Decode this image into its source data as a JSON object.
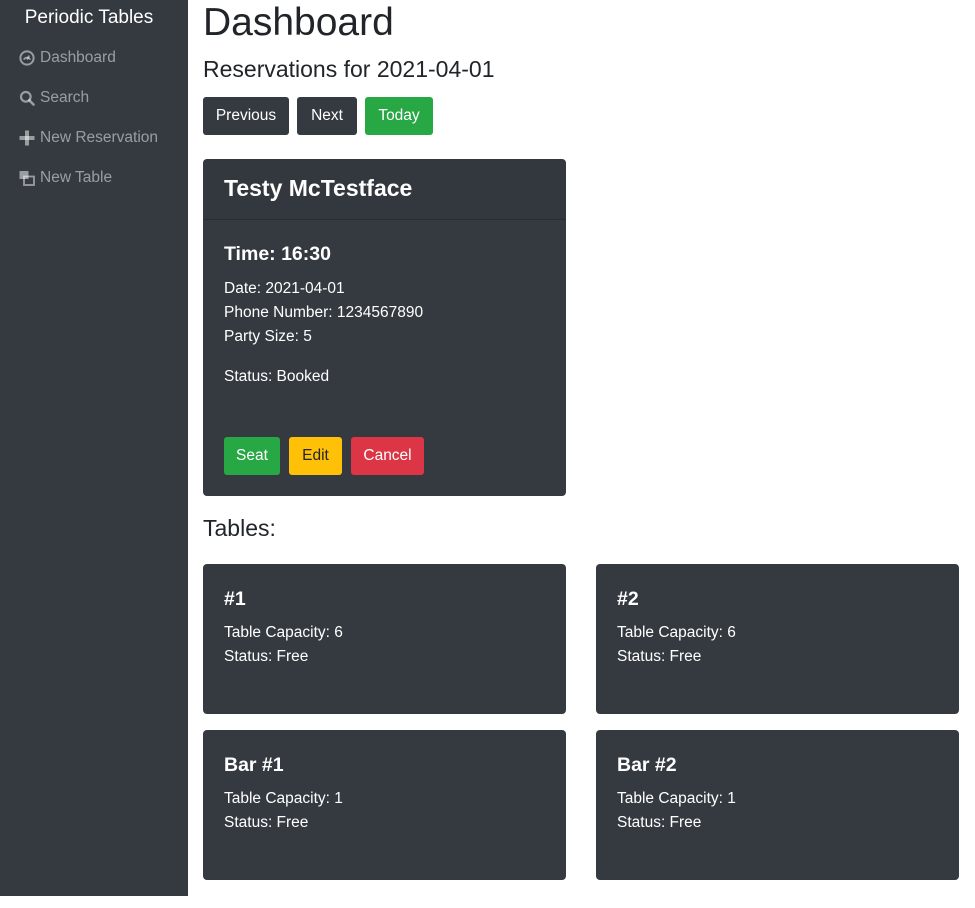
{
  "sidebar": {
    "brand": "Periodic Tables",
    "items": [
      {
        "label": "Dashboard",
        "icon": "dashboard-icon"
      },
      {
        "label": "Search",
        "icon": "search-icon"
      },
      {
        "label": "New Reservation",
        "icon": "plus-icon"
      },
      {
        "label": "New Table",
        "icon": "layers-icon"
      }
    ]
  },
  "header": {
    "title": "Dashboard",
    "subtitle": "Reservations for 2021-04-01"
  },
  "date_nav": {
    "previous": "Previous",
    "next": "Next",
    "today": "Today"
  },
  "reservation": {
    "name": "Testy McTestface",
    "time": "Time: 16:30",
    "date": "Date: 2021-04-01",
    "phone": "Phone Number: 1234567890",
    "party_size": "Party Size: 5",
    "status": "Status: Booked",
    "actions": {
      "seat": "Seat",
      "edit": "Edit",
      "cancel": "Cancel"
    }
  },
  "tables": {
    "heading": "Tables:",
    "items": [
      {
        "name": "#1",
        "capacity": "Table Capacity: 6",
        "status": "Status: Free"
      },
      {
        "name": "#2",
        "capacity": "Table Capacity: 6",
        "status": "Status: Free"
      },
      {
        "name": "Bar #1",
        "capacity": "Table Capacity: 1",
        "status": "Status: Free"
      },
      {
        "name": "Bar #2",
        "capacity": "Table Capacity: 1",
        "status": "Status: Free"
      }
    ]
  },
  "colors": {
    "sidebar_bg": "#343a40",
    "card_bg": "#343a40",
    "success": "#28a745",
    "warning": "#ffc107",
    "danger": "#dc3545"
  }
}
